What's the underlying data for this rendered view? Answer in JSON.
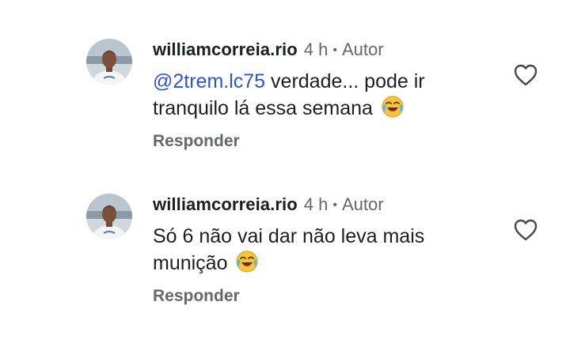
{
  "comments": [
    {
      "username": "williamcorreia.rio",
      "time": "4 h",
      "separator": "•",
      "role": "Autor",
      "mention": "@2trem.lc75",
      "text_line1": " verdade... pode ir",
      "text_line2": "tranquilo lá essa semana",
      "emoji": "face-with-tears-of-joy",
      "reply_label": "Responder",
      "like_icon": "heart-outline-icon"
    },
    {
      "username": "williamcorreia.rio",
      "time": "4 h",
      "separator": "•",
      "role": "Autor",
      "text_line1": "Só 6 não vai dar não leva mais",
      "text_line2": "munição",
      "emoji": "face-with-tears-of-joy",
      "reply_label": "Responder",
      "like_icon": "heart-outline-icon"
    }
  ],
  "colors": {
    "text": "#1c1e21",
    "secondary": "#65676b",
    "mention": "#2d55c8",
    "background": "#ffffff"
  }
}
